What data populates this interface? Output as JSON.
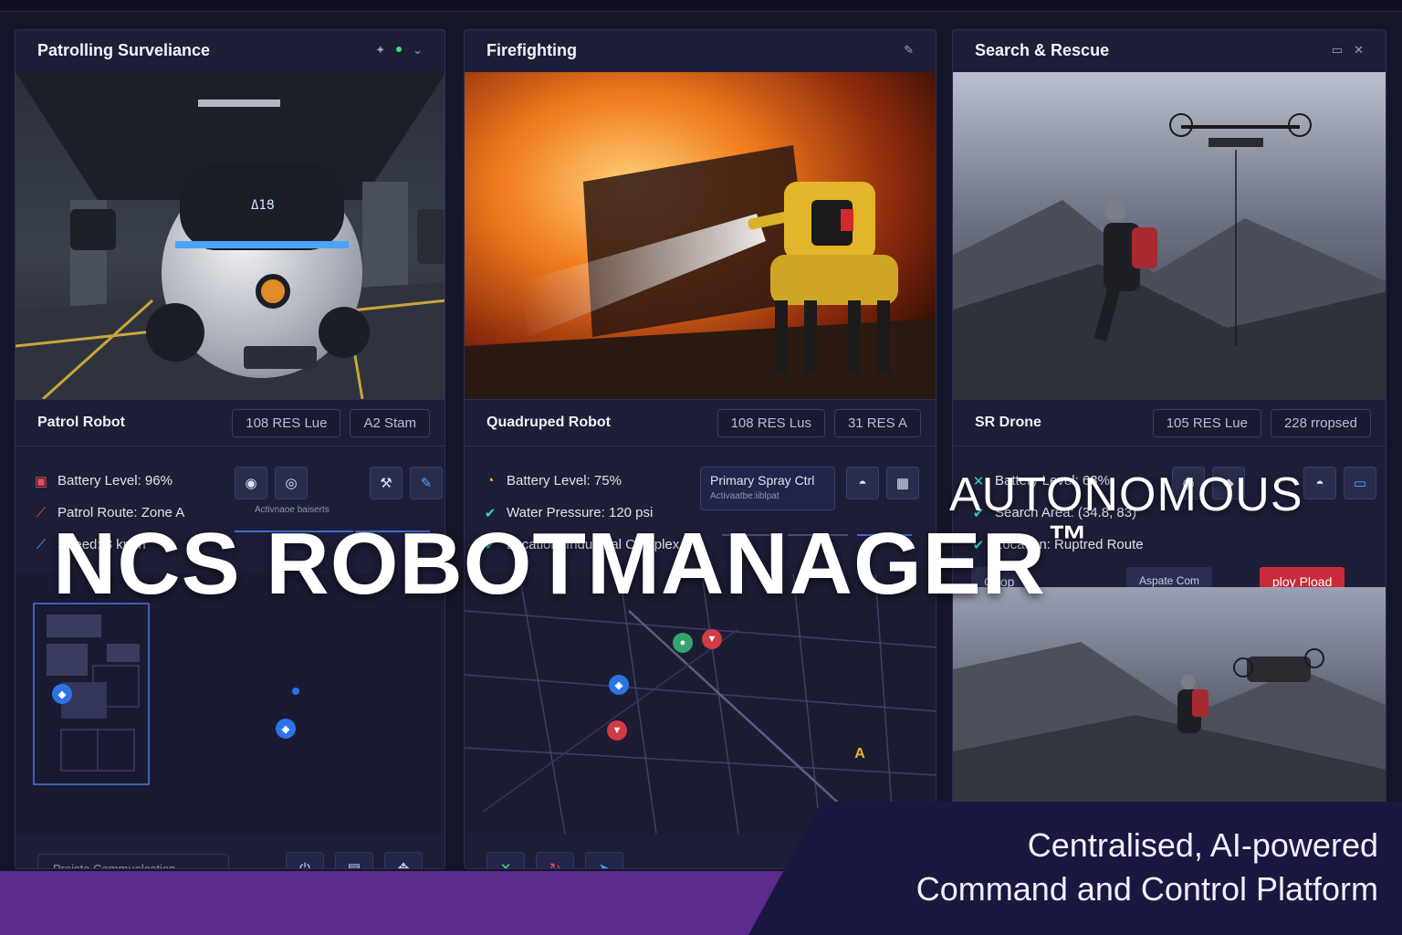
{
  "panels": [
    {
      "title": "Patrolling Surveliance",
      "robot_name": "Patrol Robot",
      "pills": [
        "108 RES Lue",
        "A2 Stam"
      ],
      "stats": [
        {
          "icon": "battery-icon",
          "text": "Battery Level: 96%"
        },
        {
          "icon": "route-icon",
          "text": "Patrol Route: Zone A"
        },
        {
          "icon": "speed-icon",
          "text": "Speed: 3 km/h"
        }
      ],
      "control_label": "Activnaoe baiserts",
      "footer_input": "Preiste Commuolcation",
      "robot_display": "Δ1Ց"
    },
    {
      "title": "Firefighting",
      "robot_name": "Quadruped Robot",
      "pills": [
        "108 RES Lus",
        "31 RES A"
      ],
      "stats": [
        {
          "icon": "battery-icon",
          "text": "Battery Level: 75%"
        },
        {
          "icon": "pressure-icon",
          "text": "Water Pressure: 120 psi"
        },
        {
          "icon": "location-icon",
          "text": "Location: Industrial Complex"
        }
      ],
      "control_title": "Primary Spray Ctrl",
      "control_label": "Activaatbe:iiblpat",
      "map_marker": "A"
    },
    {
      "title": "Search & Rescue",
      "robot_name": "SR Drone",
      "pills": [
        "105 RES Lue",
        "228 rropsed"
      ],
      "stats": [
        {
          "icon": "battery-icon",
          "text": "Battery Level: 63%"
        },
        {
          "icon": "area-icon",
          "text": "Search Area: (34.8, 83)"
        },
        {
          "icon": "location-icon",
          "text": "Location: Ruptred Route"
        }
      ],
      "left_btn": "Coop",
      "mid_btn": "Aspate Com",
      "red_btn": "ploy Pload"
    }
  ],
  "overlay": {
    "hero_title": "NCS ROBOTMANAGER",
    "hero_tm": "™",
    "hero_sub": "AUTONOMOUS",
    "tagline_1": "Centralised, AI-powered",
    "tagline_2": "Command and Control Platform"
  },
  "colors": {
    "band_purple": "#5a2a8c",
    "band_navy": "#1a1740",
    "accent_blue": "#3b6fd8",
    "alert_red": "#c92a3a"
  }
}
